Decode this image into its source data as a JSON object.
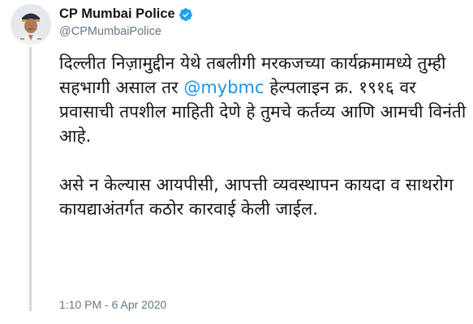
{
  "author": {
    "display_name": "CP Mumbai Police",
    "handle": "@CPMumbaiPolice",
    "verified": true
  },
  "tweet": {
    "paragraph1_before": "दिल्लीत निज़ामुद्दीन येथे तबलीगी मरकजच्या कार्यक्रमामध्ये तुम्ही सहभागी असाल तर ",
    "mention": "@mybmc",
    "paragraph1_after": " हेल्पलाइन क्र. १९१६ वर प्रवासाची तपशील माहिती देणे हे तुमचे कर्तव्य आणि आमची विनंती आहे.",
    "paragraph2": "असे न केल्यास आयपीसी, आपत्ती व्यवस्थापन कायदा व साथरोग कायद्याअंतर्गत कठोर कारवाई केली जाईल.",
    "timestamp": "1:10 PM - 6 Apr 2020"
  },
  "colors": {
    "link": "#1b95e0",
    "verified_badge": "#1da1f2",
    "secondary_text": "#657786",
    "thread_line": "#cfd9de"
  }
}
